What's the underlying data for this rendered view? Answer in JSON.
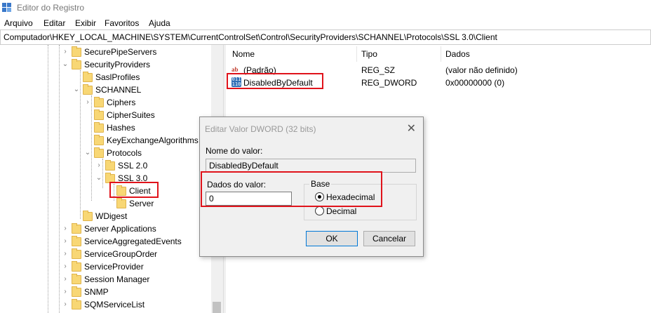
{
  "window": {
    "title": "Editor do Registro"
  },
  "menu": [
    "Arquivo",
    "Editar",
    "Exibir",
    "Favoritos",
    "Ajuda"
  ],
  "address": "Computador\\HKEY_LOCAL_MACHINE\\SYSTEM\\CurrentControlSet\\Control\\SecurityProviders\\SCHANNEL\\Protocols\\SSL 3.0\\Client",
  "tree": [
    {
      "label": "SecurePipeServers",
      "expander": "›"
    },
    {
      "label": "SecurityProviders",
      "expander": "⌄"
    },
    {
      "label": "SaslProfiles",
      "expander": ""
    },
    {
      "label": "SCHANNEL",
      "expander": "⌄"
    },
    {
      "label": "Ciphers",
      "expander": "›"
    },
    {
      "label": "CipherSuites",
      "expander": ""
    },
    {
      "label": "Hashes",
      "expander": ""
    },
    {
      "label": "KeyExchangeAlgorithms",
      "expander": ""
    },
    {
      "label": "Protocols",
      "expander": "⌄"
    },
    {
      "label": "SSL 2.0",
      "expander": "›"
    },
    {
      "label": "SSL 3.0",
      "expander": "⌄"
    },
    {
      "label": "Client",
      "expander": ""
    },
    {
      "label": "Server",
      "expander": ""
    },
    {
      "label": "WDigest",
      "expander": ""
    },
    {
      "label": "Server Applications",
      "expander": "›"
    },
    {
      "label": "ServiceAggregatedEvents",
      "expander": "›"
    },
    {
      "label": "ServiceGroupOrder",
      "expander": "›"
    },
    {
      "label": "ServiceProvider",
      "expander": "›"
    },
    {
      "label": "Session Manager",
      "expander": "›"
    },
    {
      "label": "SNMP",
      "expander": "›"
    },
    {
      "label": "SQMServiceList",
      "expander": "›"
    }
  ],
  "list": {
    "headers": {
      "name": "Nome",
      "type": "Tipo",
      "data": "Dados"
    },
    "rows": [
      {
        "name": "(Padrão)",
        "type": "REG_SZ",
        "data": "(valor não definido)",
        "icon": "string-value-icon",
        "glyph": "ab"
      },
      {
        "name": "DisabledByDefault",
        "type": "REG_DWORD",
        "data": "0x00000000 (0)",
        "icon": "binary-value-icon",
        "glyph": "011 110"
      }
    ]
  },
  "dialog": {
    "title": "Editar Valor DWORD (32 bits)",
    "close": "✕",
    "name_label": "Nome do valor:",
    "name_value": "DisabledByDefault",
    "data_label": "Dados do valor:",
    "data_value": "0",
    "base_label": "Base",
    "hex_label": "Hexadecimal",
    "dec_label": "Decimal",
    "ok": "OK",
    "cancel": "Cancelar"
  }
}
